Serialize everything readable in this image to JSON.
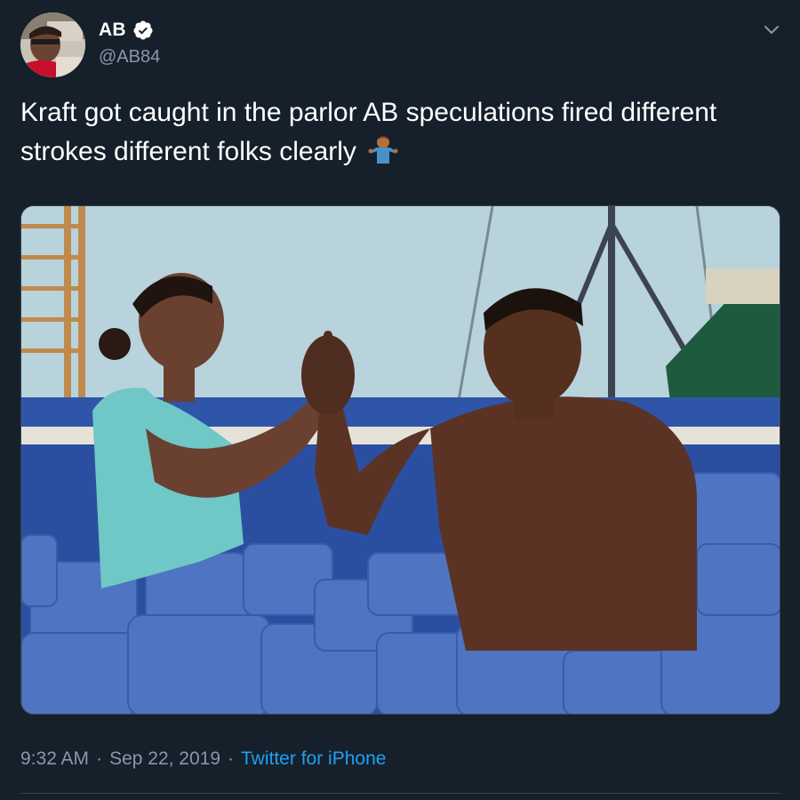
{
  "author": {
    "display_name": "AB",
    "handle": "@AB84",
    "verified": true
  },
  "tweet": {
    "text": "Kraft got caught in the parlor AB speculations fired different strokes different folks clearly",
    "emoji": "person-shrugging-emoji"
  },
  "meta": {
    "time": "9:32 AM",
    "separator": "·",
    "date": "Sep 22, 2019",
    "source": "Twitter for iPhone"
  },
  "colors": {
    "background": "#15202b",
    "secondary_text": "#8899a6",
    "link": "#1da1f2",
    "verified_badge": "#ffffff"
  },
  "icons": [
    "verified-badge-icon",
    "chevron-down-icon"
  ]
}
